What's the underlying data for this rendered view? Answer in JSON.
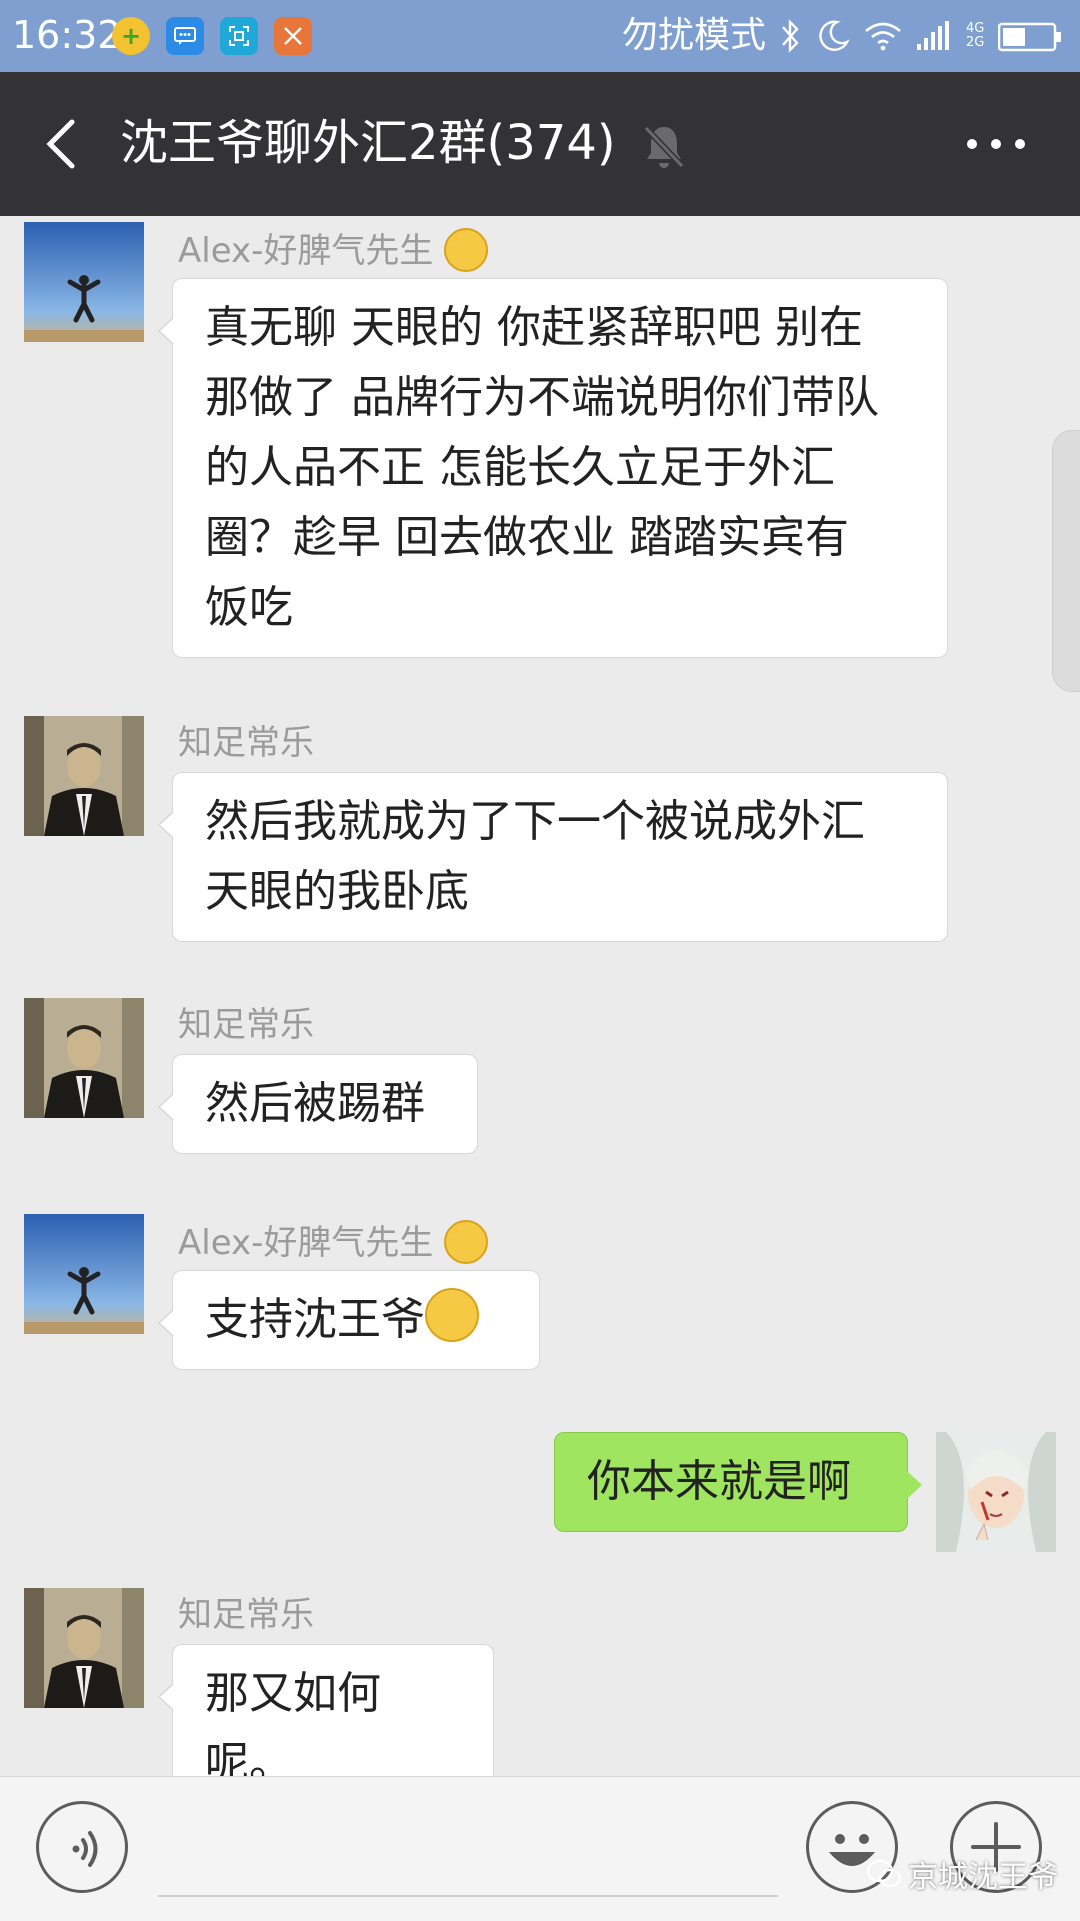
{
  "status_bar": {
    "time": "16:32",
    "dnd_text": "勿扰模式",
    "network": "4G 2G",
    "icons": [
      "360-security-icon",
      "message-icon",
      "scan-icon",
      "shuffle-icon",
      "bluetooth-icon",
      "moon-icon",
      "wifi-icon",
      "signal-icon",
      "battery-icon"
    ]
  },
  "header": {
    "title": "沈王爷聊外汇2群(374)",
    "icons": [
      "back-arrow-icon",
      "muted-bell-icon",
      "more-dots-icon"
    ]
  },
  "messages": [
    {
      "side": "left",
      "sender": "Alex-好脾气先生",
      "sender_emoji": "smile-emoji-icon",
      "lines": [
        "真无聊 天眼的 你赶紧辞职吧 别在",
        "那做了 品牌行为不端说明你们带队",
        "的人品不正 怎能长久立足于外汇",
        "圈？趁早 回去做农业 踏踏实宾有",
        "饭吃"
      ]
    },
    {
      "side": "left",
      "sender": "知足常乐",
      "lines": [
        "然后我就成为了下一个被说成外汇",
        "天眼的我卧底"
      ]
    },
    {
      "side": "left",
      "sender": "知足常乐",
      "lines": [
        "然后被踢群"
      ]
    },
    {
      "side": "left",
      "sender": "Alex-好脾气先生",
      "sender_emoji": "smile-emoji-icon",
      "text": "支持沈王爷",
      "text_emoji": "smile-emoji-icon"
    },
    {
      "side": "right",
      "text": "你本来就是啊"
    },
    {
      "side": "left",
      "sender": "知足常乐",
      "text": "那又如何呢。"
    }
  ],
  "input_bar": {
    "icons": [
      "voice-icon",
      "emoji-icon",
      "plus-icon"
    ]
  },
  "watermark": "京城沈王爷",
  "colors": {
    "status_bar": "#7e9fcf",
    "title_bar": "#333336",
    "chat_bg": "#ebebeb",
    "bubble_self": "#9fe55f",
    "bubble_other": "#ffffff"
  }
}
